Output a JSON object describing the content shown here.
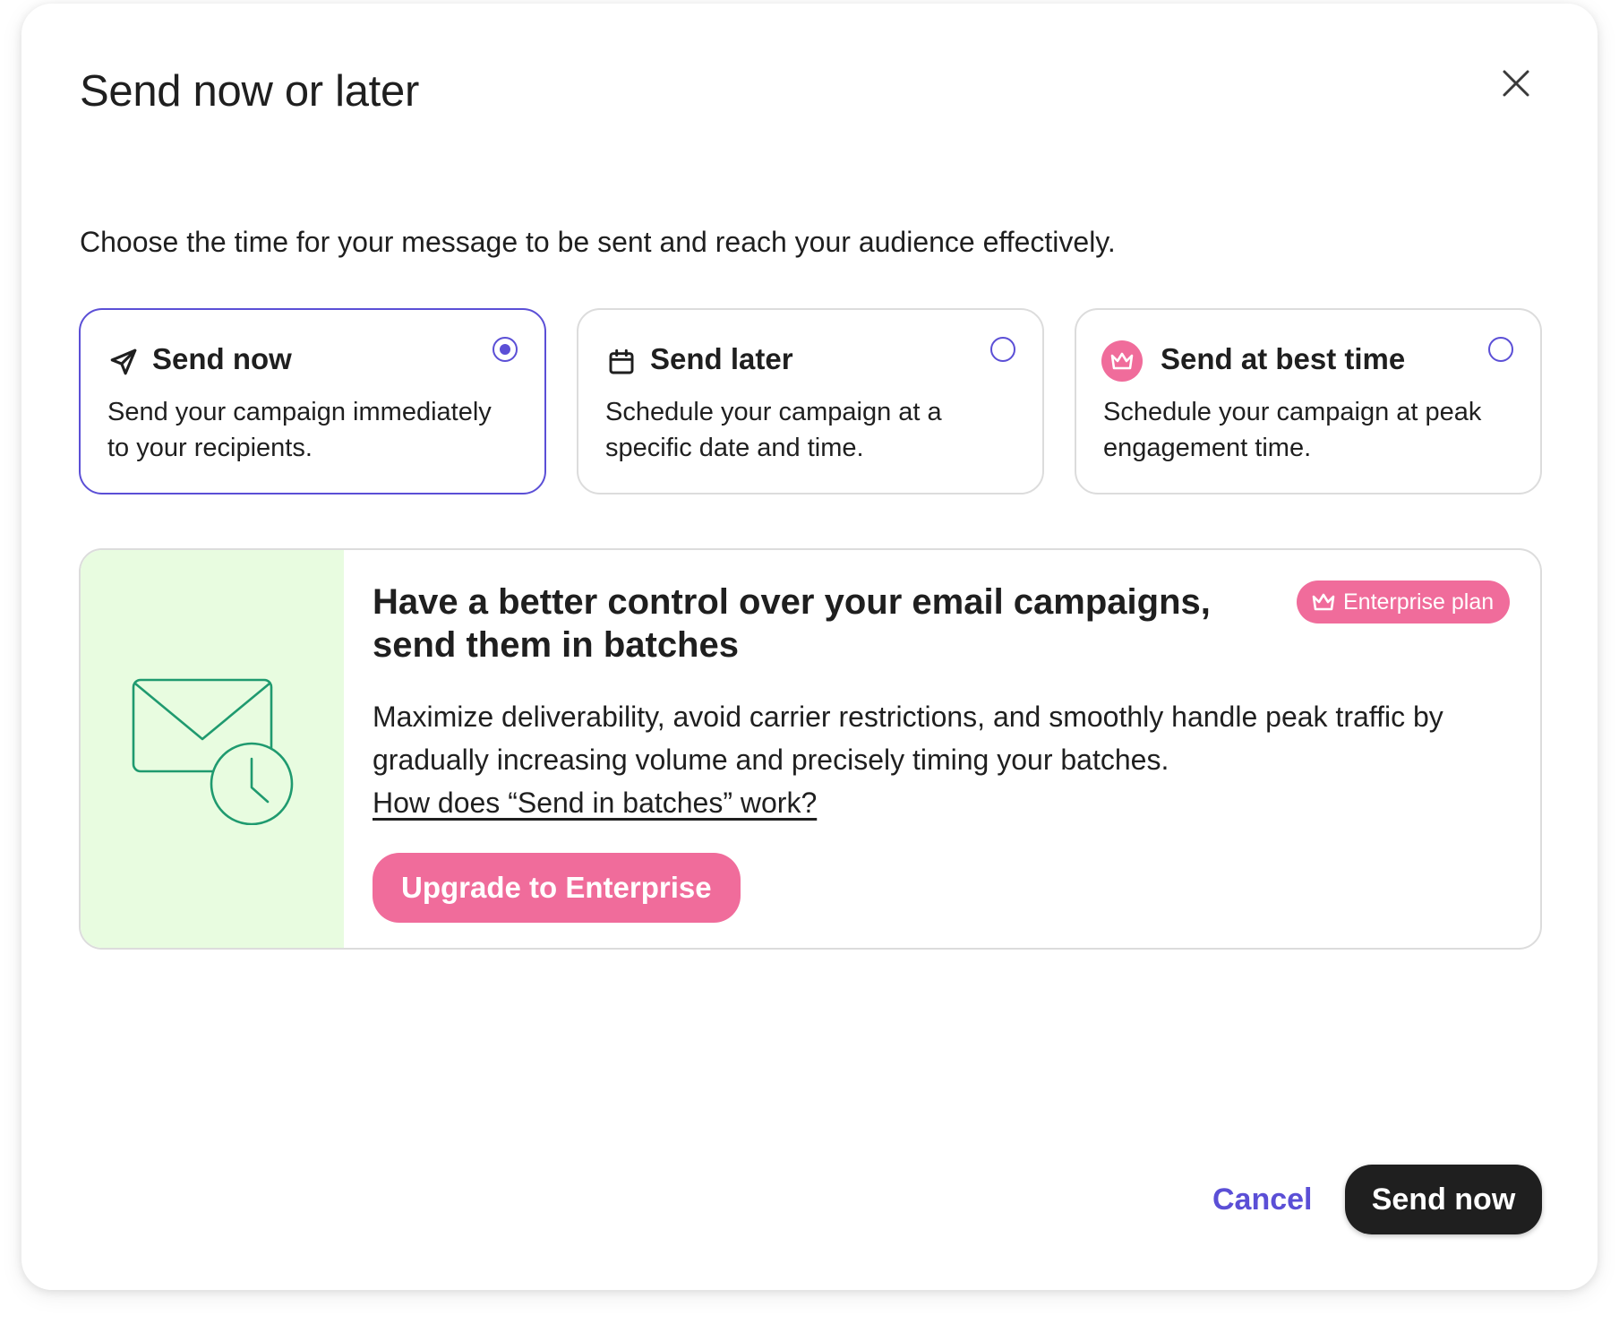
{
  "dialog": {
    "title": "Send now or later",
    "subtitle": "Choose the time for your message to be sent and reach your audience effectively."
  },
  "options": [
    {
      "title": "Send now",
      "description": "Send your campaign immediately to your recipients.",
      "icon": "paper-plane-icon",
      "selected": true
    },
    {
      "title": "Send later",
      "description": "Schedule your campaign at a specific date and time.",
      "icon": "calendar-icon",
      "selected": false
    },
    {
      "title": "Send at best time",
      "description": "Schedule your campaign at peak engagement time.",
      "icon": "crown-icon",
      "selected": false
    }
  ],
  "promo": {
    "title": "Have a better control over your email campaigns, send them in batches",
    "badge": "Enterprise plan",
    "description": "Maximize deliverability, avoid carrier restrictions, and smoothly handle peak traffic by gradually increasing volume and precisely timing your batches.",
    "link": "How does “Send in batches” work?",
    "button": "Upgrade to Enterprise",
    "illustration": "envelope-clock-icon"
  },
  "footer": {
    "cancel": "Cancel",
    "confirm": "Send now"
  },
  "colors": {
    "accent": "#5b4fd6",
    "pink": "#f06c9b",
    "promo_bg": "#e8fce0",
    "illustration": "#1f9a6f",
    "dark_button": "#1f1f1f"
  }
}
